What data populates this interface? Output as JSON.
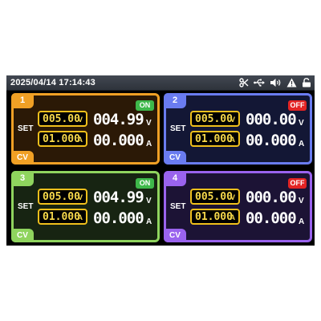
{
  "status_bar": {
    "datetime": "2025/04/14 17:14:43",
    "icons": [
      "scissors-icon",
      "usb-icon",
      "speaker-icon",
      "warning-icon",
      "unlock-icon"
    ]
  },
  "channels": [
    {
      "number": "1",
      "status": "ON",
      "set_label": "SET",
      "set_voltage": "005.00",
      "set_voltage_unit": "V",
      "set_current": "01.000",
      "set_current_unit": "A",
      "out_voltage": "004.99",
      "out_voltage_unit": "V",
      "out_current": "00.000",
      "out_current_unit": "A",
      "mode": "CV",
      "color": "#f0a025"
    },
    {
      "number": "2",
      "status": "OFF",
      "set_label": "SET",
      "set_voltage": "005.00",
      "set_voltage_unit": "V",
      "set_current": "01.000",
      "set_current_unit": "A",
      "out_voltage": "000.00",
      "out_voltage_unit": "V",
      "out_current": "00.000",
      "out_current_unit": "A",
      "mode": "CV",
      "color": "#6a7cf0"
    },
    {
      "number": "3",
      "status": "ON",
      "set_label": "SET",
      "set_voltage": "005.00",
      "set_voltage_unit": "V",
      "set_current": "01.000",
      "set_current_unit": "A",
      "out_voltage": "004.99",
      "out_voltage_unit": "V",
      "out_current": "00.000",
      "out_current_unit": "A",
      "mode": "CV",
      "color": "#8fd45e"
    },
    {
      "number": "4",
      "status": "OFF",
      "set_label": "SET",
      "set_voltage": "005.00",
      "set_voltage_unit": "V",
      "set_current": "01.000",
      "set_current_unit": "A",
      "out_voltage": "000.00",
      "out_voltage_unit": "V",
      "out_current": "00.000",
      "out_current_unit": "A",
      "mode": "CV",
      "color": "#9a63ee"
    }
  ],
  "colors": {
    "on": "#3eb84a",
    "off": "#e32424",
    "set_box": "#f0c01c"
  }
}
